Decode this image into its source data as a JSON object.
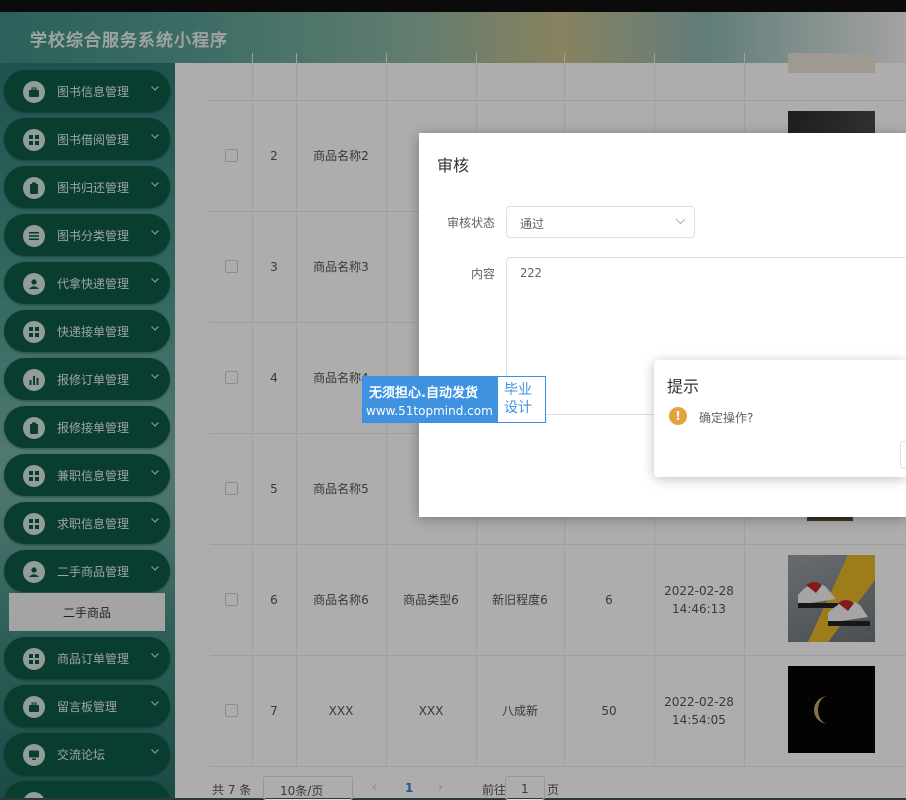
{
  "app": {
    "title": "学校综合服务系统小程序"
  },
  "sidebar": {
    "items": [
      {
        "label": "图书信息管理",
        "icon": "briefcase-icon"
      },
      {
        "label": "图书借阅管理",
        "icon": "grid-icon"
      },
      {
        "label": "图书归还管理",
        "icon": "clipboard-icon"
      },
      {
        "label": "图书分类管理",
        "icon": "list-icon"
      },
      {
        "label": "代拿快递管理",
        "icon": "user-icon"
      },
      {
        "label": "快递接单管理",
        "icon": "grid-icon"
      },
      {
        "label": "报修订单管理",
        "icon": "bar-chart-icon"
      },
      {
        "label": "报修接单管理",
        "icon": "clipboard-icon"
      },
      {
        "label": "兼职信息管理",
        "icon": "grid-icon"
      },
      {
        "label": "求职信息管理",
        "icon": "grid-icon"
      },
      {
        "label": "二手商品管理",
        "icon": "user-icon"
      },
      {
        "label": "商品订单管理",
        "icon": "grid-icon"
      },
      {
        "label": "留言板管理",
        "icon": "briefcase-icon"
      },
      {
        "label": "交流论坛",
        "icon": "monitor-icon"
      }
    ],
    "sub_item": "二手商品"
  },
  "table": {
    "rows": [
      {
        "idx": "2",
        "name": "商品名称2",
        "type": "商",
        "cond": "",
        "qty": "",
        "date": "",
        "time": "",
        "img": "dark"
      },
      {
        "idx": "3",
        "name": "商品名称3",
        "type": "商",
        "cond": "",
        "qty": "",
        "date": "",
        "time": "",
        "img": "none"
      },
      {
        "idx": "4",
        "name": "商品名称4",
        "type": "商",
        "cond": "",
        "qty": "",
        "date": "",
        "time": "",
        "img": "none"
      },
      {
        "idx": "5",
        "name": "商品名称5",
        "type": "商",
        "cond": "",
        "qty": "",
        "date": "",
        "time": "",
        "img": "dark-small"
      },
      {
        "idx": "6",
        "name": "商品名称6",
        "type": "商品类型6",
        "cond": "新旧程度6",
        "qty": "6",
        "date": "2022-02-28",
        "time": "14:46:13",
        "img": "shoes"
      },
      {
        "idx": "7",
        "name": "XXX",
        "type": "XXX",
        "cond": "八成新",
        "qty": "50",
        "date": "2022-02-28",
        "time": "14:54:05",
        "img": "moon"
      }
    ]
  },
  "pager": {
    "total": "共 7 条",
    "size": "10条/页",
    "prev": "‹",
    "page": "1",
    "next": "›",
    "goto": "前往",
    "goto_value": "1",
    "page_word": "页"
  },
  "dialog": {
    "title": "审核",
    "status_label": "审核状态",
    "status_value": "通过",
    "content_label": "内容",
    "content_value": "222"
  },
  "confirm": {
    "title": "提示",
    "icon": "!",
    "message": "确定操作?"
  },
  "watermark": {
    "line1": "无须担心.自动发货",
    "line2": "www.51topmind.com",
    "line3": "毕业",
    "line4": "设计"
  },
  "colors": {
    "menu_bg": "#0e5a47",
    "accent": "#2c7be5",
    "warning": "#e6a23c"
  }
}
